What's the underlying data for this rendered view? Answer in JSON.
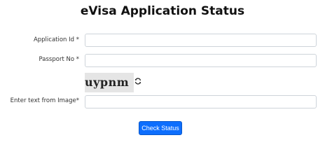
{
  "page": {
    "title": "eVisa Application Status"
  },
  "form": {
    "application_id": {
      "label": "Application Id *",
      "value": "",
      "placeholder": ""
    },
    "passport_no": {
      "label": "Passport No *",
      "value": "",
      "placeholder": ""
    },
    "captcha": {
      "text": "uypnm",
      "refresh_icon": "refresh-icon"
    },
    "captcha_input": {
      "label": "Enter text from Image*",
      "value": "",
      "placeholder": ""
    },
    "submit_label": "Check Status"
  },
  "colors": {
    "button": "#0d6efd",
    "border": "#ced4da",
    "captcha_bg": "#e5e5e5"
  }
}
